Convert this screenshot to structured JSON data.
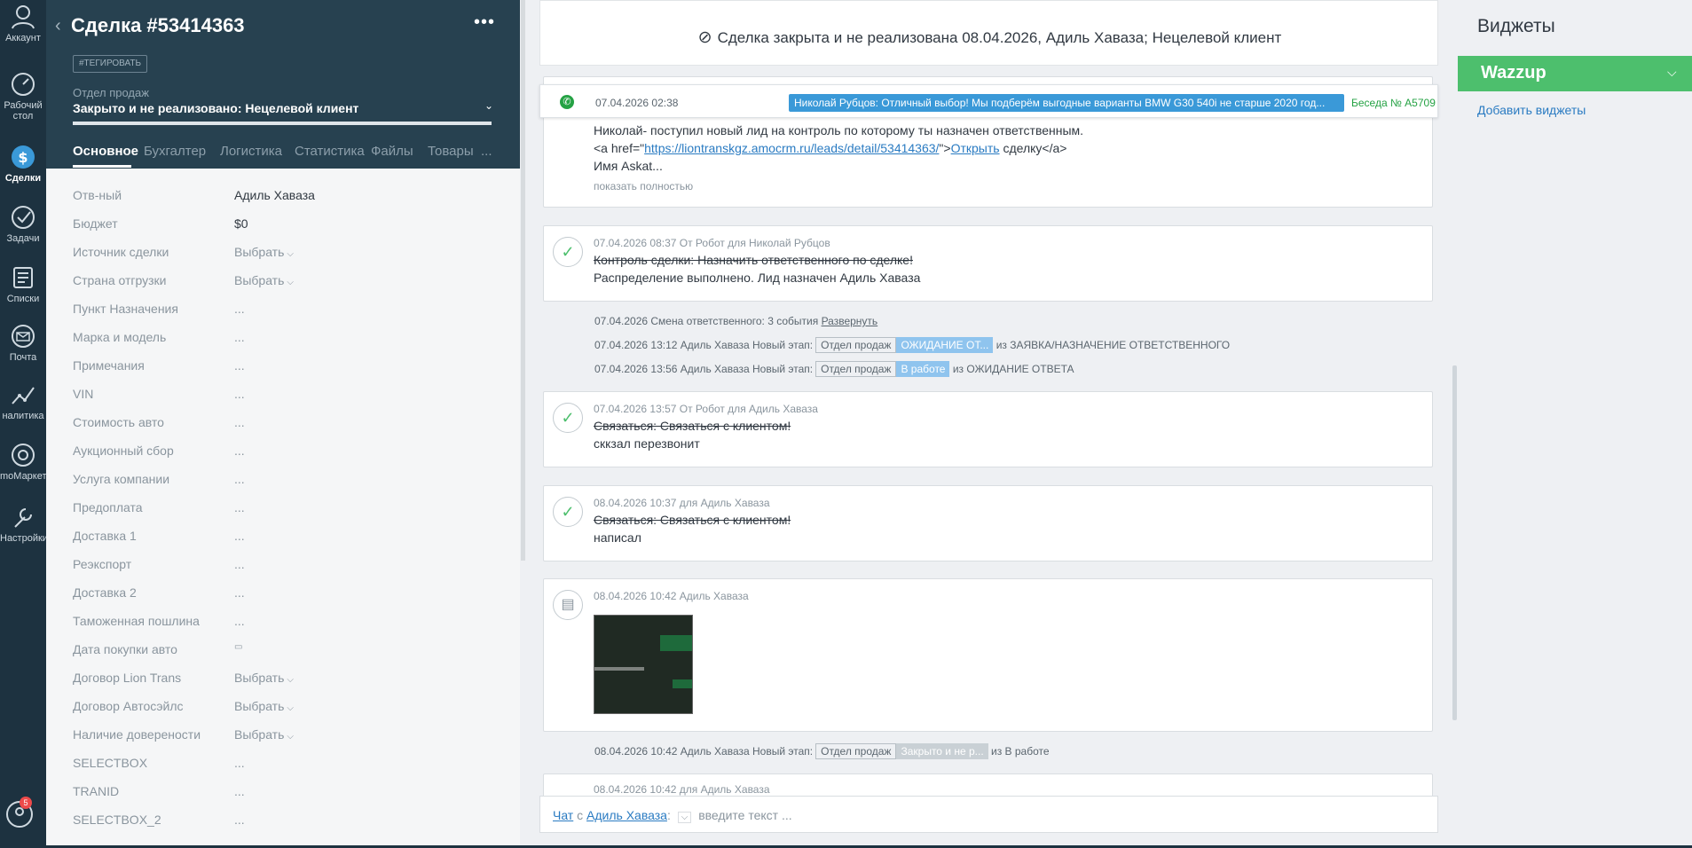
{
  "nav": {
    "items": [
      {
        "label": "Аккаунт",
        "icon": "user-icon"
      },
      {
        "label": "Рабочий стол",
        "icon": "dashboard-icon"
      },
      {
        "label": "Сделки",
        "icon": "deals-icon"
      },
      {
        "label": "Задачи",
        "icon": "tasks-icon"
      },
      {
        "label": "Списки",
        "icon": "lists-icon"
      },
      {
        "label": "Почта",
        "icon": "mail-icon"
      },
      {
        "label": "налитика",
        "icon": "analytics-icon"
      },
      {
        "label": "moМаркет",
        "icon": "market-icon"
      },
      {
        "label": "Настройки",
        "icon": "settings-icon"
      }
    ],
    "badge": "5"
  },
  "deal": {
    "title": "Сделка #53414363",
    "tag_button": "#ТЕГИРОВАТЬ",
    "pipeline": "Отдел продаж",
    "status": "Закрыто и не реализовано: Нецелевой клиент",
    "tabs": [
      "Основное",
      "Бухгалтер",
      "Логистика",
      "Статистика",
      "Файлы",
      "Товары",
      "..."
    ]
  },
  "fields": [
    {
      "label": "Отв-ный",
      "value": "Адиль Хаваза"
    },
    {
      "label": "Бюджет",
      "value": "$0"
    },
    {
      "label": "Источник сделки",
      "value": "Выбрать"
    },
    {
      "label": "Страна отгрузки",
      "value": "Выбрать"
    },
    {
      "label": "Пункт Назначения",
      "value": "..."
    },
    {
      "label": "Марка и модель",
      "value": "..."
    },
    {
      "label": "Примечания",
      "value": "..."
    },
    {
      "label": "VIN",
      "value": "..."
    },
    {
      "label": "Стоимость авто",
      "value": "..."
    },
    {
      "label": "Аукционный сбор",
      "value": "..."
    },
    {
      "label": "Услуга компании",
      "value": "..."
    },
    {
      "label": "Предоплата",
      "value": "..."
    },
    {
      "label": "Доставка 1",
      "value": "..."
    },
    {
      "label": "Реэкспорт",
      "value": "..."
    },
    {
      "label": "Доставка 2",
      "value": "..."
    },
    {
      "label": "Таможенная пошлина",
      "value": "..."
    },
    {
      "label": "Дата покупки авто",
      "value": "▭"
    },
    {
      "label": "Договор Lion Trans",
      "value": "Выбрать"
    },
    {
      "label": "Договор Автосэйлс",
      "value": "Выбрать"
    },
    {
      "label": "Наличие довереноcти",
      "value": "Выбрать"
    },
    {
      "label": "SELECTBOX",
      "value": "..."
    },
    {
      "label": "TRANID",
      "value": "..."
    },
    {
      "label": "SELECTBOX_2",
      "value": "..."
    }
  ],
  "feed": {
    "closed_banner": "Сделка закрыта и не реализована 08.04.2026, Адиль Хаваза; Нецелевой клиент",
    "whatsapp": {
      "date": "07.04.2026 02:38",
      "message": "Николай Рубцов: Отличный выбор! Мы подберём выгодные варианты BMW G30 540i не старше 2020 год...",
      "conversation": "Беседа № A5709"
    },
    "note1": {
      "line1": "Николай- поступил новый лид на контроль по которому ты назначен ответственным.",
      "line2_pre": "<a href=\"",
      "line2_link": "https://liontranskgz.amocrm.ru/leads/detail/53414363/",
      "line2_mid": "\">",
      "line2_link2": "Открыть",
      "line2_post": " сделку</a>",
      "line3": "Имя Askat...",
      "show_full": "показать полностью"
    },
    "task1": {
      "meta": "07.04.2026 08:37  От Робот для Николай Рубцов",
      "title": "Контроль сделки: Назначить ответственного по сделке!",
      "result": "Распределение выполнено. Лид назначен Адиль Хаваза"
    },
    "events": [
      {
        "text": "07.04.2026 Смена ответственного: 3 события",
        "link": "Развернуть"
      },
      {
        "text": "07.04.2026 13:12 Адиль Хаваза Новый этап:",
        "pipe": "Отдел продаж",
        "stage": "ОЖИДАНИЕ ОТ...",
        "from": "из ЗАЯВКА/НАЗНАЧЕНИЕ ОТВЕТСТВЕННОГО"
      },
      {
        "text": "07.04.2026 13:56 Адиль Хаваза Новый этап:",
        "pipe": "Отдел продаж",
        "stage": "В работе",
        "from": "из ОЖИДАНИЕ ОТВЕТА"
      }
    ],
    "task2": {
      "meta": "07.04.2026 13:57  От Робот для Адиль Хаваза",
      "title": "Связаться: Связаться с клиентом!",
      "result": "сккзал перезвонит"
    },
    "task3": {
      "meta": "08.04.2026 10:37  для Адиль Хаваза",
      "title": "Связаться: Связаться с клиентом!",
      "result": "написал"
    },
    "file_note": {
      "meta": "08.04.2026 10:42 Адиль Хаваза"
    },
    "event_last": {
      "text": "08.04.2026 10:42 Адиль Хаваза Новый этап:",
      "pipe": "Отдел продаж",
      "stage": "Закрыто и не р...",
      "from": "из В работе"
    },
    "task4_meta": "08.04.2026 10:42  для Адиль Хаваза",
    "chat": {
      "prefix": "Чат",
      "with": "с",
      "user": "Адиль Хаваза",
      "colon": ":",
      "placeholder": "введите текст ..."
    }
  },
  "widgets": {
    "title": "Виджеты",
    "wazzup": "Wazzup",
    "add": "Добавить виджеты"
  }
}
